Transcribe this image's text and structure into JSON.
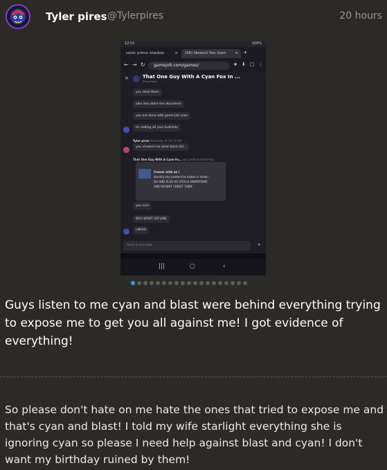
{
  "post": {
    "author_name": "Tyler pires",
    "author_handle": "@Tylerpires",
    "timestamp": "20 hours",
    "title": "Guys listen to me cyan and blast were behind everything trying to expose me to get you all against me! I got evidence of everything!",
    "body": "So please don't hate on me hate the ones that tried to expose me and that's cyan and blast! I told my wife starlight everything she is ignoring cyan so please I need help against blast and cyan! I don't want my birthday ruined by them!",
    "carousel_total": 19,
    "carousel_active_index": 0
  },
  "screenshot": {
    "status_time": "12:51",
    "status_right": "100%",
    "tabs": [
      {
        "label": "sonic prime shadow",
        "close": "×"
      },
      {
        "label": "(98) Newest Fan Gam",
        "close": "×"
      }
    ],
    "new_tab": "+",
    "url": "gamejolt.com/games/",
    "chat_title": "That One Guy With A Cyan Fox In ...",
    "chat_subtitle": "@CyanBlast",
    "messages": [
      "you steal them",
      "also ima share the document",
      "you are done with game jolt soon",
      "im adding all your bullshits",
      "you showed me what blast did...",
      "you sure",
      "BRO WENT OFFLINE",
      "LMFAO"
    ],
    "sender_tyler": "Tyler pires",
    "sender_tyler_time": "Yesterday at 10:33 AM",
    "sender_cyan": "That One Guy With A Cyan Fo...",
    "sender_cyan_time": "@CyanBlast Yesterday",
    "quote_name": "freezer with an i",
    "quote_lines": [
      "literally any content he makes is stolen",
      "OH AND ALSO HE STEALS ANIMATIONS",
      "AND DOSENT CREDIT THEM"
    ],
    "input_placeholder": "Send a message",
    "send_icon": "➤",
    "nav_recent": "|||",
    "nav_home": "○",
    "nav_back": "‹"
  },
  "colors": {
    "background": "#2c2a27",
    "accent_dot": "#2ba0e6",
    "muted_text": "#9a968f"
  },
  "icons": [
    "avatar-image",
    "back-arrow-icon",
    "forward-arrow-icon",
    "reload-icon",
    "star-icon",
    "download-icon",
    "menu-icon",
    "send-icon"
  ]
}
